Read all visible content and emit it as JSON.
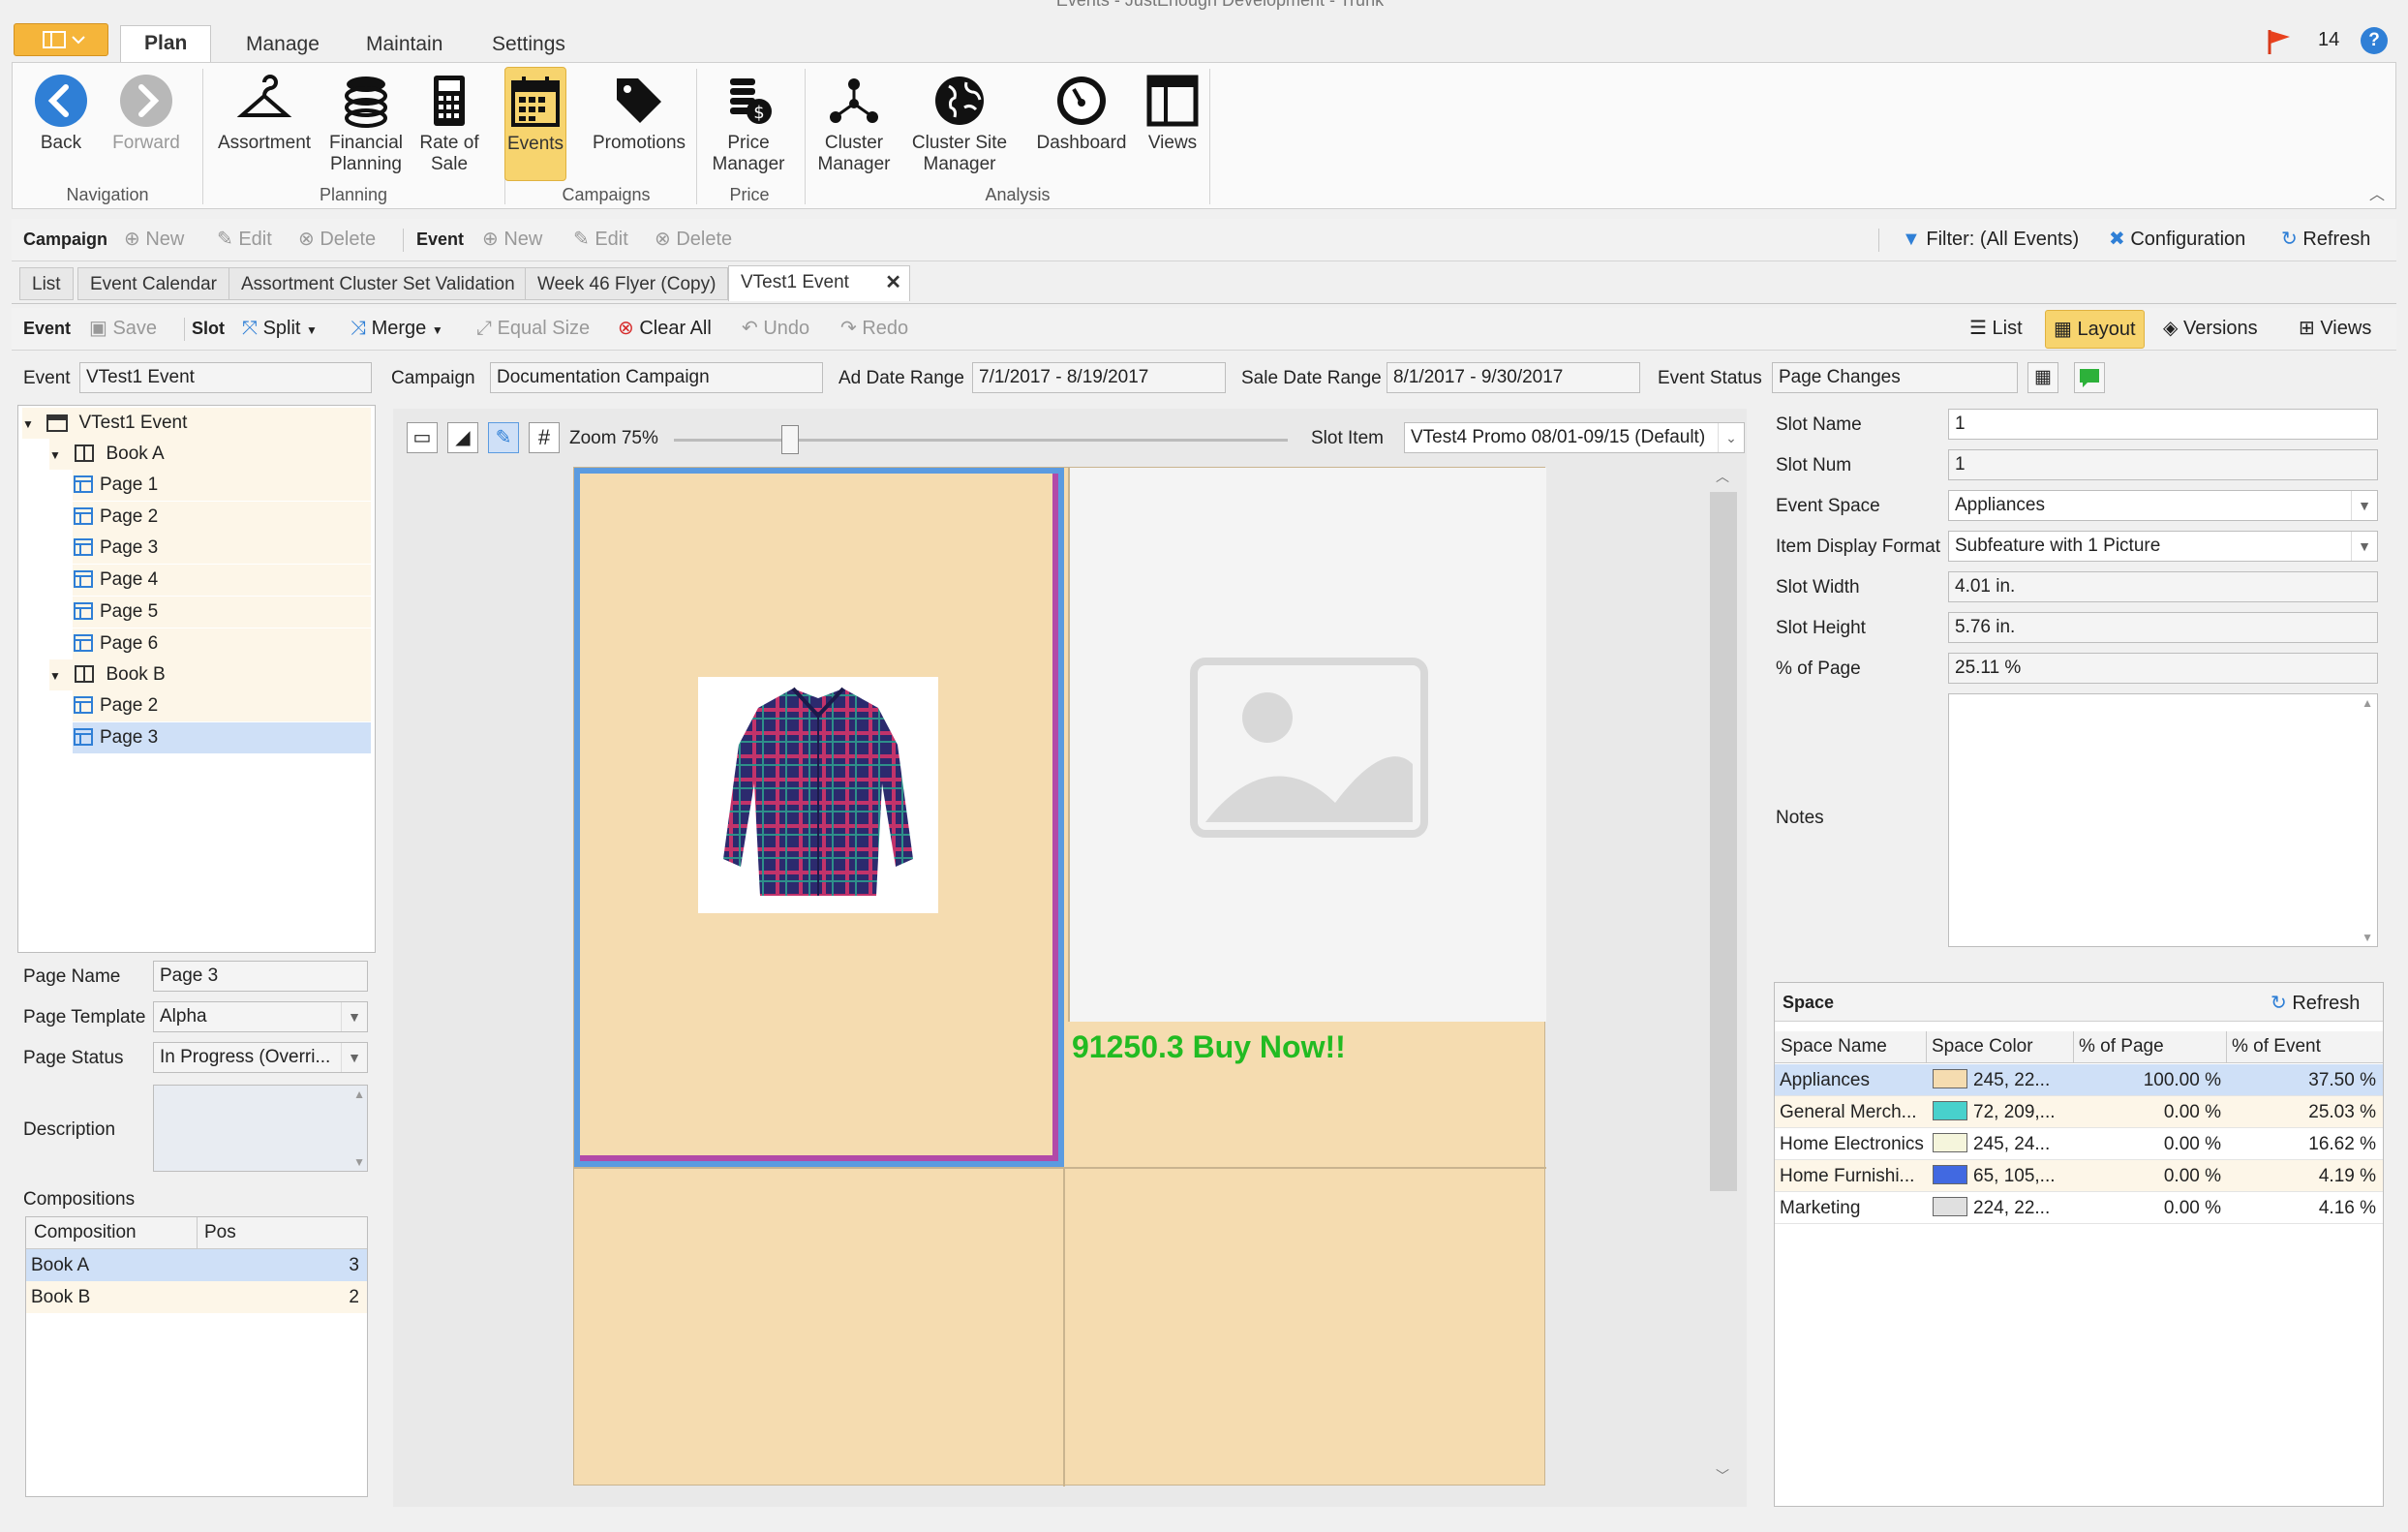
{
  "window": {
    "title": "Events - JustEnough Development - Trunk",
    "notifications": "14"
  },
  "ribbon": {
    "tabs": [
      "Plan",
      "Manage",
      "Maintain",
      "Settings"
    ],
    "buttons": {
      "back": "Back",
      "forward": "Forward",
      "assortment": "Assortment",
      "financial1": "Financial",
      "financial2": "Planning",
      "ros1": "Rate of",
      "ros2": "Sale",
      "events": "Events",
      "promotions": "Promotions",
      "price1": "Price",
      "price2": "Manager",
      "cluster1": "Cluster",
      "cluster2": "Manager",
      "csm1": "Cluster Site",
      "csm2": "Manager",
      "dashboard": "Dashboard",
      "views": "Views"
    },
    "groups": {
      "navigation": "Navigation",
      "planning": "Planning",
      "campaigns": "Campaigns",
      "price": "Price",
      "analysis": "Analysis"
    }
  },
  "campaign_toolbar": {
    "campaign": "Campaign",
    "new": "New",
    "edit": "Edit",
    "delete": "Delete",
    "event": "Event",
    "new2": "New",
    "edit2": "Edit",
    "delete2": "Delete",
    "filter": "Filter: (All Events)",
    "configuration": "Configuration",
    "refresh": "Refresh"
  },
  "doc_tabs": [
    "List",
    "Event Calendar",
    "Assortment Cluster Set Validation",
    "Week 46 Flyer (Copy)",
    "VTest1 Event"
  ],
  "event_toolbar": {
    "event": "Event",
    "save": "Save",
    "slot": "Slot",
    "split": "Split",
    "merge": "Merge",
    "equal_size": "Equal Size",
    "clear_all": "Clear All",
    "undo": "Undo",
    "redo": "Redo",
    "list": "List",
    "layout": "Layout",
    "versions": "Versions",
    "views": "Views"
  },
  "header_fields": {
    "event_label": "Event",
    "event_value": "VTest1 Event",
    "campaign_label": "Campaign",
    "campaign_value": "Documentation Campaign",
    "ad_label": "Ad Date Range",
    "ad_value": "7/1/2017 - 8/19/2017",
    "sale_label": "Sale Date Range",
    "sale_value": "8/1/2017 - 9/30/2017",
    "status_label": "Event Status",
    "status_value": "Page Changes"
  },
  "tree": {
    "root": "VTest1 Event",
    "book_a": "Book A",
    "book_a_pages": [
      "Page 1",
      "Page 2",
      "Page 3",
      "Page 4",
      "Page 5",
      "Page 6"
    ],
    "book_b": "Book B",
    "book_b_pages": [
      "Page 2",
      "Page 3"
    ]
  },
  "page_props": {
    "name_label": "Page Name",
    "name_value": "Page 3",
    "template_label": "Page Template",
    "template_value": "Alpha",
    "status_label": "Page Status",
    "status_value": "In Progress (Overri...",
    "desc_label": "Description",
    "compositions_label": "Compositions",
    "comp_headers": [
      "Composition",
      "Pos"
    ],
    "comp_rows": [
      {
        "name": "Book A",
        "pos": "3"
      },
      {
        "name": "Book B",
        "pos": "2"
      }
    ]
  },
  "canvas": {
    "zoom": "Zoom 75%",
    "zoom_level": 0.18,
    "slot_item_label": "Slot Item",
    "slot_item_value": "VTest4 Promo 08/01-09/15 (Default)",
    "promo_text": "91250.3 Buy Now!!"
  },
  "slot_props": {
    "slot_name_label": "Slot Name",
    "slot_name_value": "1",
    "slot_num_label": "Slot Num",
    "slot_num_value": "1",
    "space_label": "Event Space",
    "space_value": "Appliances",
    "format_label": "Item Display Format",
    "format_value": "Subfeature with 1 Picture",
    "width_label": "Slot Width",
    "width_value": "4.01 in.",
    "height_label": "Slot Height",
    "height_value": "5.76 in.",
    "pct_label": "% of Page",
    "pct_value": "25.11 %",
    "notes_label": "Notes"
  },
  "space_panel": {
    "title": "Space",
    "refresh": "Refresh",
    "headers": [
      "Space Name",
      "Space Color",
      "% of Page",
      "% of Event"
    ],
    "rows": [
      {
        "name": "Appliances",
        "color": "245, 22...",
        "hex": "#f5dcb0",
        "page": "100.00 %",
        "event": "37.50 %"
      },
      {
        "name": "General Merch...",
        "color": "72, 209,...",
        "hex": "#48d1cc",
        "page": "0.00 %",
        "event": "25.03 %"
      },
      {
        "name": "Home Electronics",
        "color": "245, 24...",
        "hex": "#f5f5dc",
        "page": "0.00 %",
        "event": "16.62 %"
      },
      {
        "name": "Home Furnishi...",
        "color": "65, 105,...",
        "hex": "#4169e1",
        "page": "0.00 %",
        "event": "4.19 %"
      },
      {
        "name": "Marketing",
        "color": "224, 22...",
        "hex": "#e0e0e0",
        "page": "0.00 %",
        "event": "4.16 %"
      }
    ]
  },
  "colors": {
    "accent": "#f7d46e",
    "slot_fill": "#f5dcb0",
    "selection": "#cfe0f7",
    "promo_green": "#22bb22"
  }
}
